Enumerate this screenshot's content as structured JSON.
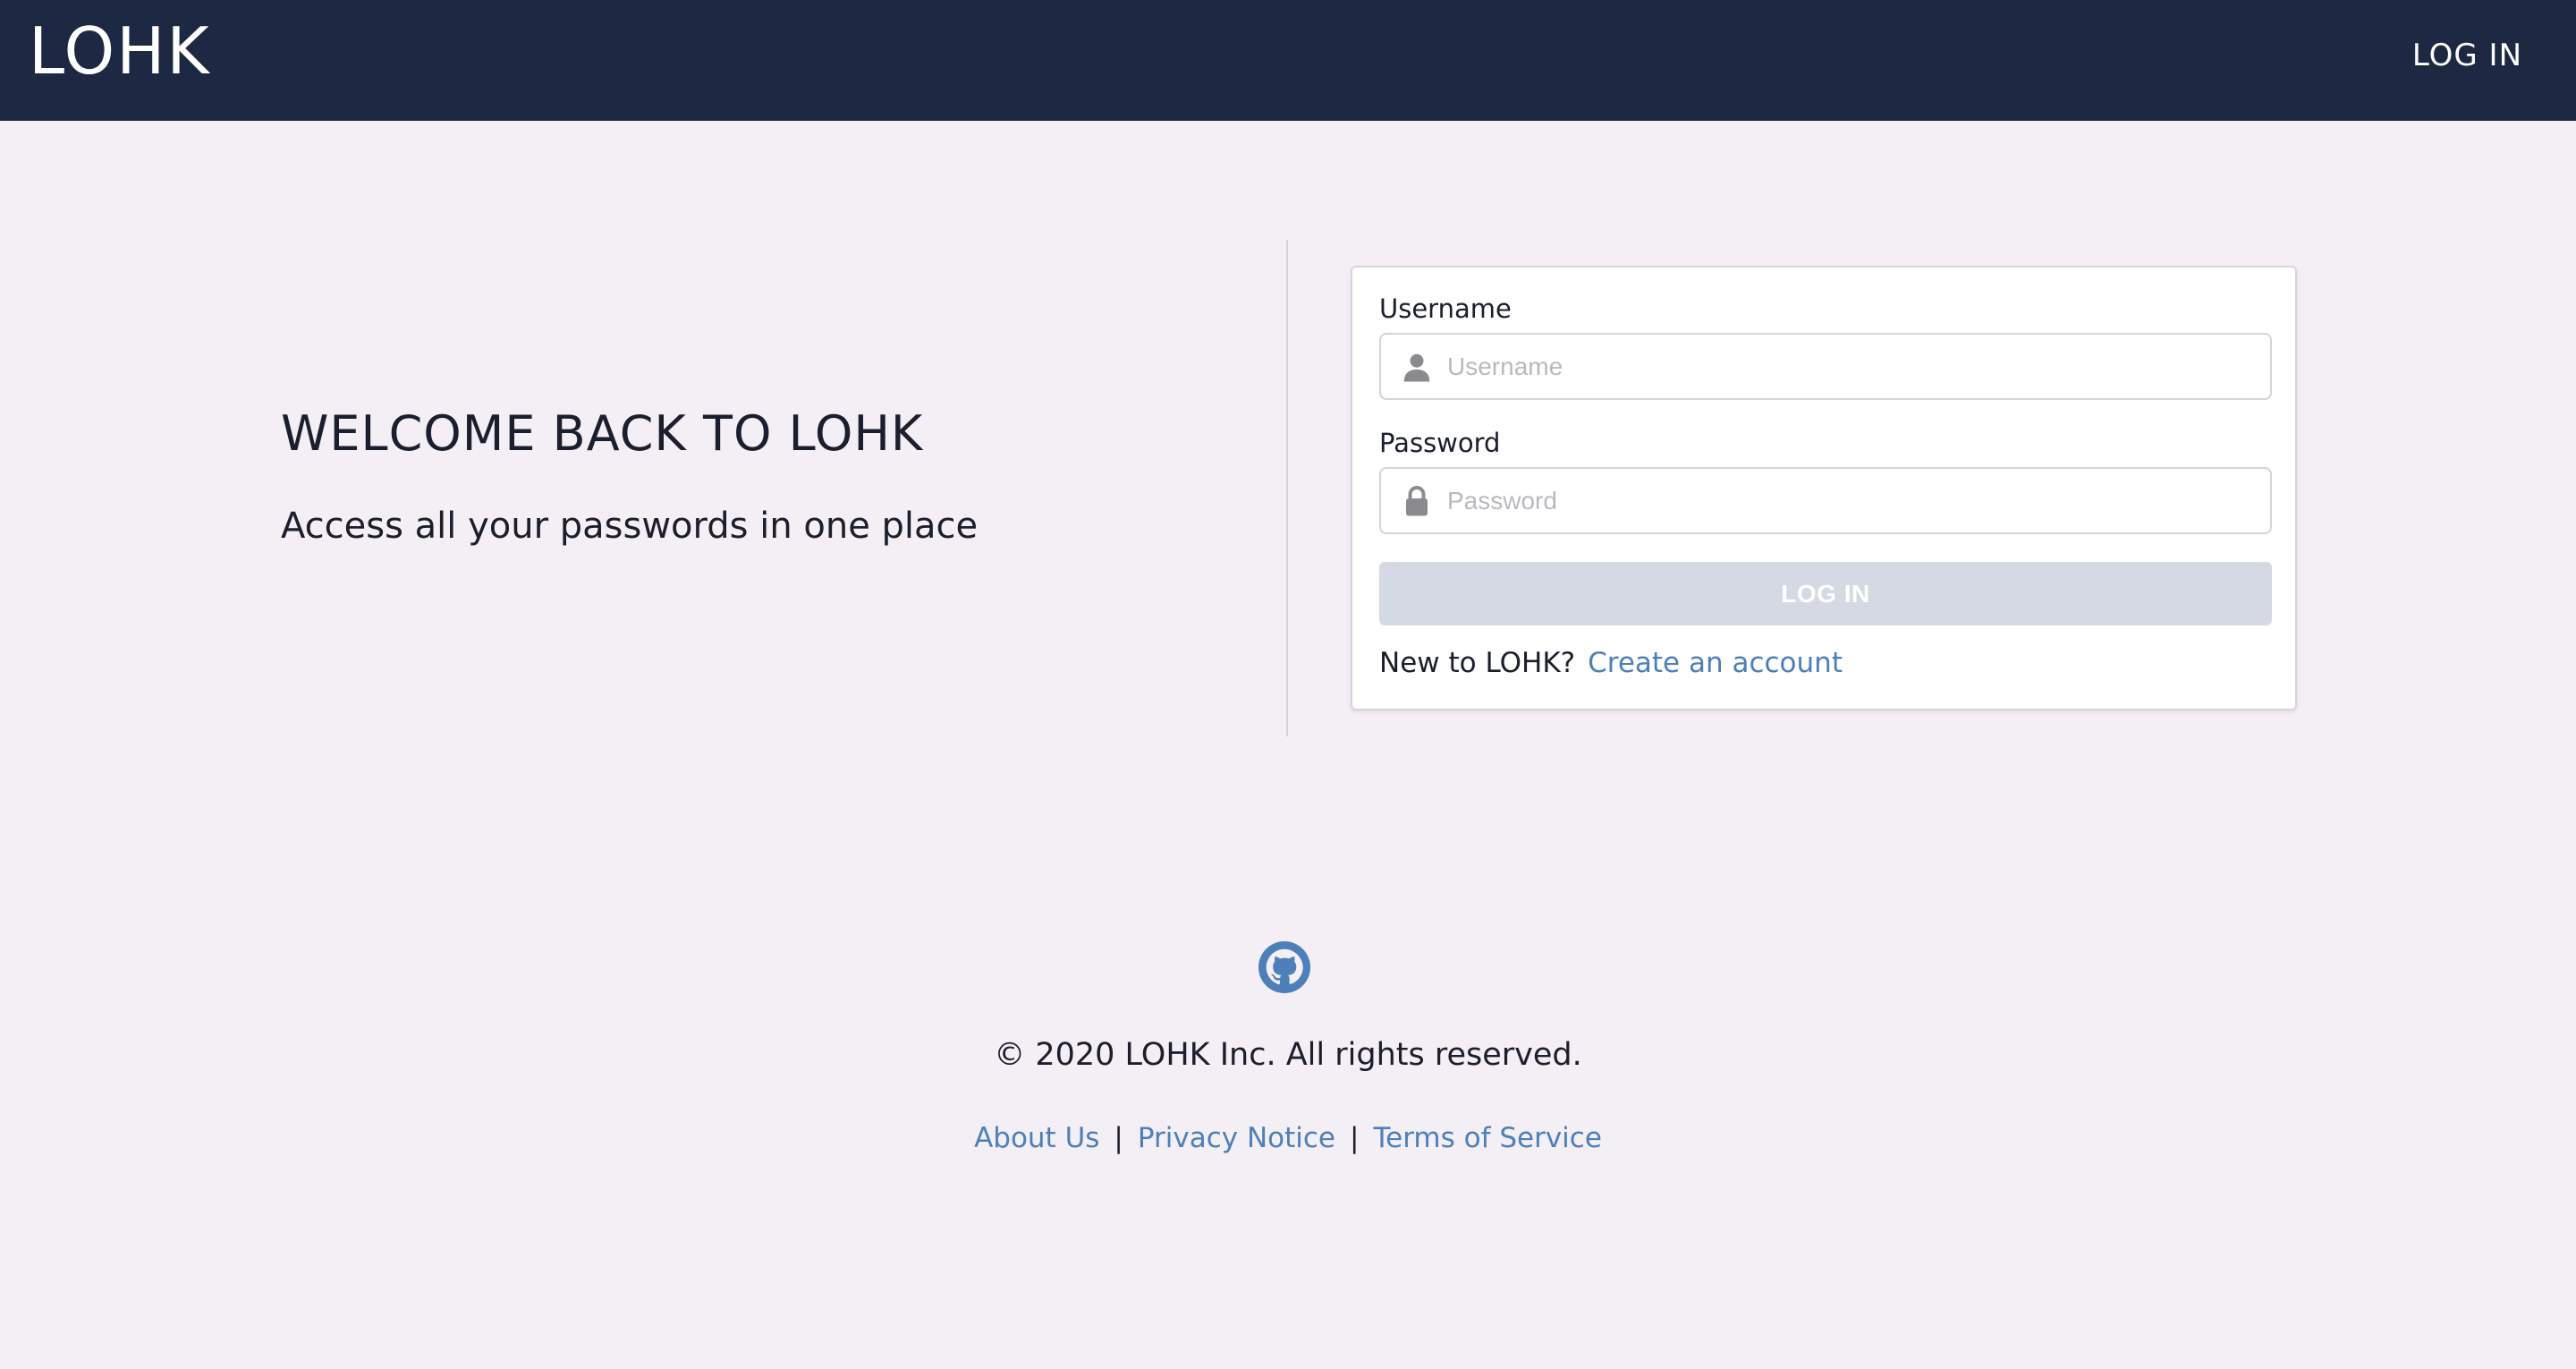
{
  "navbar": {
    "brand": "LOHK",
    "login_label": "LOG IN"
  },
  "hero": {
    "title": "WELCOME BACK TO LOHK",
    "subtitle": "Access all your passwords in one place"
  },
  "login_form": {
    "username_label": "Username",
    "username_placeholder": "Username",
    "username_value": "",
    "password_label": "Password",
    "password_placeholder": "Password",
    "password_value": "",
    "submit_label": "LOG IN",
    "signup_prompt": "New to LOHK?",
    "signup_link": "Create an account",
    "user_icon": "user-icon",
    "lock_icon": "lock-icon"
  },
  "footer": {
    "icon": "github-icon",
    "copyright": "© 2020 LOHK Inc. All rights reserved.",
    "links": [
      "About Us",
      "Privacy Notice",
      "Terms of Service"
    ],
    "separator": "|"
  },
  "colors": {
    "navbar_bg": "#1d2843",
    "page_bg": "#f4eff5",
    "link": "#4d7fb9",
    "button_disabled": "#d4d9e3"
  }
}
